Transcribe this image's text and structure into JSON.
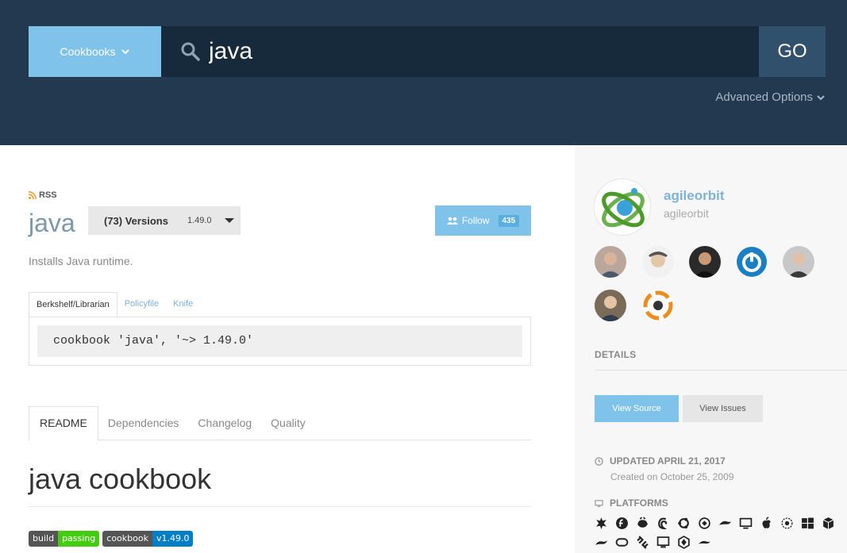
{
  "search": {
    "category": "Cookbooks",
    "query": "java",
    "go_label": "GO",
    "advanced_label": "Advanced Options"
  },
  "cookbook": {
    "rss_label": "RSS",
    "name": "java",
    "versions_label": "(73) Versions",
    "version": "1.49.0",
    "follow_label": "Follow",
    "follow_count": "435",
    "description": "Installs Java runtime."
  },
  "install": {
    "tabs": [
      "Berkshelf/Librarian",
      "Policyfile",
      "Knife"
    ],
    "code": "cookbook 'java', '~> 1.49.0'"
  },
  "readme": {
    "tabs": [
      "README",
      "Dependencies",
      "Changelog",
      "Quality"
    ],
    "heading": "java cookbook",
    "badges": [
      {
        "left": "build",
        "right": "passing"
      },
      {
        "left": "cookbook",
        "right": "v1.49.0"
      }
    ]
  },
  "sidebar": {
    "owner_name": "agileorbit",
    "owner_username": "agileorbit",
    "details_heading": "DETAILS",
    "view_source_label": "View Source",
    "view_issues_label": "View Issues",
    "updated_label": "UPDATED APRIL 21, 2017",
    "created_label": "Created on October 25, 2009",
    "platforms_label": "PLATFORMS",
    "platforms": [
      "centos-icon",
      "fedora-icon",
      "redhat-icon",
      "debian-icon",
      "ubuntu-icon",
      "scientific-icon",
      "oracle-icon",
      "xenserver-icon",
      "mac-os-x-icon",
      "suse-icon",
      "windows-icon",
      "amazon-icon",
      "arch-icon",
      "freebsd-icon",
      "smartos-icon",
      "mint-icon",
      "openbsd-icon",
      "opensuse-icon"
    ]
  },
  "colors": {
    "header_bg": "#22394f",
    "accent_blue": "#7fc3ea",
    "title_blue": "#7b97ad",
    "link_blue": "#7fb2d8",
    "badge_green": "#44cc11",
    "badge_blue": "#007ec6"
  }
}
